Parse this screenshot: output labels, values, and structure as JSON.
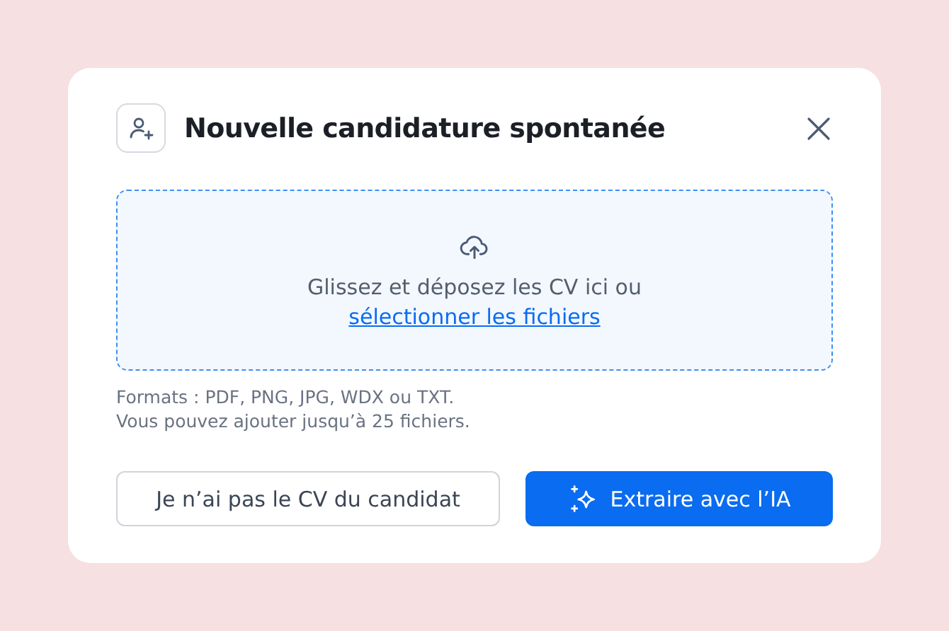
{
  "dialog": {
    "title": "Nouvelle candidature spontanée",
    "dropzone": {
      "text": "Glissez et déposez les CV ici ou",
      "link": "sélectionner les fichiers"
    },
    "hints": [
      "Formats : PDF, PNG, JPG, WDX ou TXT.",
      "Vous pouvez ajouter jusqu’à 25 fichiers."
    ],
    "buttons": [
      {
        "label": "Je n’ai pas le CV du candidat",
        "kind": "secondary"
      },
      {
        "label": "Extraire avec l’IA",
        "kind": "primary"
      }
    ]
  }
}
